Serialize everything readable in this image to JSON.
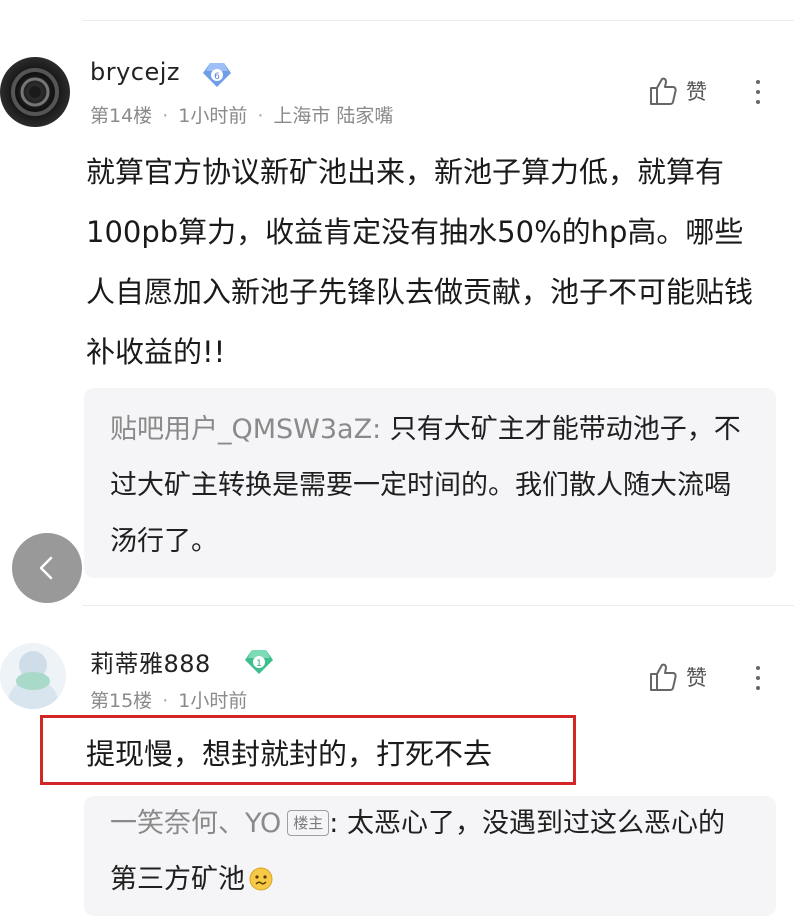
{
  "comments": [
    {
      "username": "brycejz",
      "badge_level": "6",
      "floor": "第14楼",
      "time": "1小时前",
      "location": "上海市 陆家嘴",
      "like_label": "赞",
      "content": "就算官方协议新矿池出来，新池子算力低，就算有100pb算力，收益肯定没有抽水50%的hp高。哪些人自愿加入新池子先锋队去做贡献，池子不可能贴钱补收益的!!",
      "reply": {
        "user": "贴吧用户_QMSW3aZ:",
        "text": " 只有大矿主才能带动池子，不过大矿主转换是需要一定时间的。我们散人随大流喝汤行了。"
      }
    },
    {
      "username": "莉蒂雅888",
      "badge_level": "1",
      "floor": "第15楼",
      "time": "1小时前",
      "like_label": "赞",
      "content": "提现慢，想封就封的，打死不去",
      "reply": {
        "user": "一笑奈何、YO",
        "owner_tag": "楼主",
        "text": ": 太恶心了，没遇到过这么恶心的第三方矿池",
        "emoji": "confused-face-emoji"
      }
    }
  ],
  "colors": {
    "highlight": "#d32626",
    "badge_blue": "#6f9ee8",
    "badge_green": "#3fbf8f"
  }
}
